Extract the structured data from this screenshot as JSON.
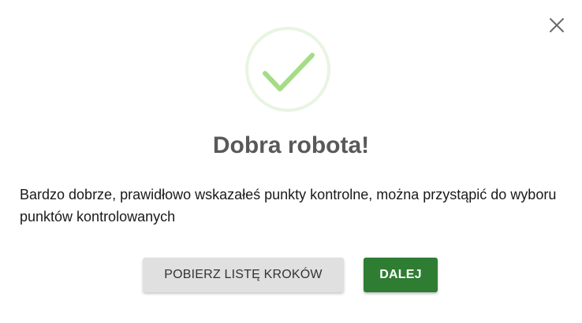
{
  "dialog": {
    "title": "Dobra robota!",
    "message": "Bardzo dobrze, prawidłowo wskazałeś punkty kontrolne, można przystąpić do wyboru punktów kontrolowanych",
    "close_icon": "close-icon",
    "status_icon": "checkmark-icon",
    "buttons": {
      "download_label": "POBIERZ LISTĘ KROKÓW",
      "next_label": "DALEJ"
    }
  },
  "colors": {
    "success_ring": "#e8f5e1",
    "success_check": "#a5dc86",
    "primary_button": "#2e7d32",
    "secondary_button": "#e0e0e0",
    "title_text": "#595959"
  }
}
